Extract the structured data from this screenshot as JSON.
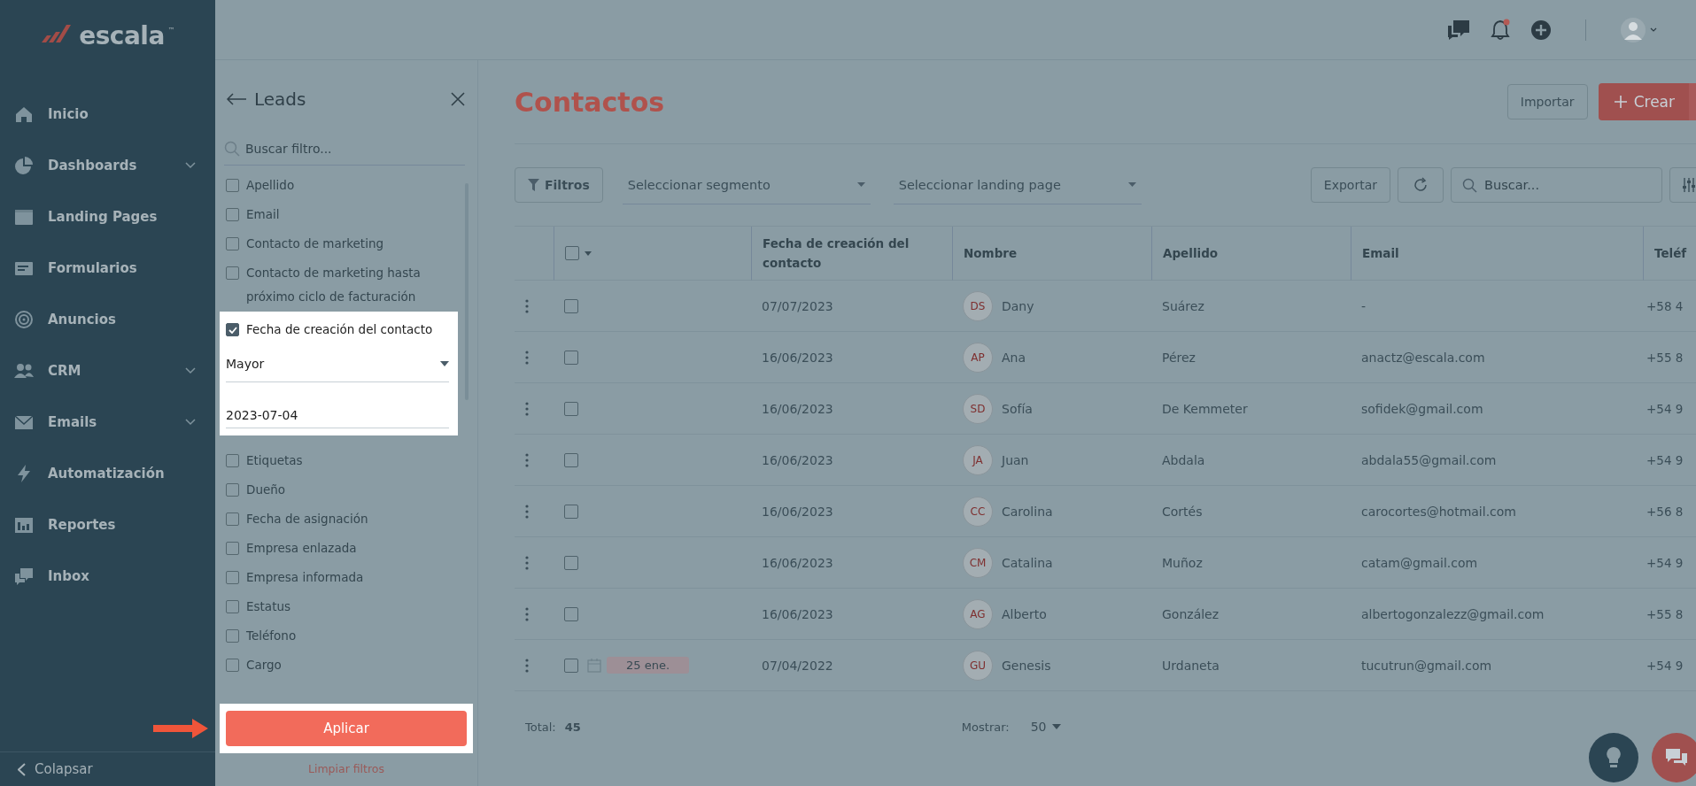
{
  "logo": {
    "text": "escala",
    "trademark": "™"
  },
  "nav": [
    {
      "label": "Inicio",
      "expandable": false
    },
    {
      "label": "Dashboards",
      "expandable": true
    },
    {
      "label": "Landing Pages",
      "expandable": false
    },
    {
      "label": "Formularios",
      "expandable": false
    },
    {
      "label": "Anuncios",
      "expandable": false
    },
    {
      "label": "CRM",
      "expandable": true
    },
    {
      "label": "Emails",
      "expandable": true
    },
    {
      "label": "Automatización",
      "expandable": false
    },
    {
      "label": "Reportes",
      "expandable": false
    },
    {
      "label": "Inbox",
      "expandable": false
    }
  ],
  "collapse": {
    "label": "Colapsar"
  },
  "header": {
    "has_notification": true
  },
  "filter_panel": {
    "title": "Leads",
    "search_placeholder": "Buscar filtro...",
    "filters": [
      {
        "label": "Apellido",
        "checked": false,
        "spotlight": false
      },
      {
        "label": "Email",
        "checked": false,
        "spotlight": false
      },
      {
        "label": "Contacto de marketing",
        "checked": false,
        "spotlight": false
      },
      {
        "label": "Contacto de marketing hasta próximo ciclo de facturación",
        "checked": false,
        "spotlight": false
      },
      {
        "label": "Fecha de creación del contacto",
        "checked": true,
        "spotlight": true,
        "condition": "Mayor",
        "value": "2023-07-04"
      },
      {
        "label": "Etiquetas",
        "checked": false,
        "spotlight": false
      },
      {
        "label": "Dueño",
        "checked": false,
        "spotlight": false
      },
      {
        "label": "Fecha de asignación",
        "checked": false,
        "spotlight": false
      },
      {
        "label": "Empresa enlazada",
        "checked": false,
        "spotlight": false
      },
      {
        "label": "Empresa informada",
        "checked": false,
        "spotlight": false
      },
      {
        "label": "Estatus",
        "checked": false,
        "spotlight": false
      },
      {
        "label": "Teléfono",
        "checked": false,
        "spotlight": false
      },
      {
        "label": "Cargo",
        "checked": false,
        "spotlight": false
      }
    ],
    "apply": {
      "label": "Aplicar",
      "spotlight": true
    },
    "clear": "Limpiar filtros"
  },
  "page": {
    "title": "Contactos",
    "import": "Importar",
    "create": "Crear"
  },
  "toolbar": {
    "filters": "Filtros",
    "segment_placeholder": "Seleccionar segmento",
    "landing_placeholder": "Seleccionar landing page",
    "export": "Exportar",
    "search_placeholder": "Buscar..."
  },
  "table": {
    "all_selected": false,
    "columns": [
      "Fecha de creación del contacto",
      "Nombre",
      "Apellido",
      "Email",
      "Teléf"
    ],
    "rows": [
      {
        "selected": false,
        "date": "07/07/2023",
        "initials": "DS",
        "name": "Dany",
        "surname": "Suárez",
        "email": "-",
        "phone": "+58 4"
      },
      {
        "selected": false,
        "date": "16/06/2023",
        "initials": "AP",
        "name": "Ana",
        "surname": "Pérez",
        "email": "anactz@escala.com",
        "phone": "+55 8"
      },
      {
        "selected": false,
        "date": "16/06/2023",
        "initials": "SD",
        "name": "Sofía",
        "surname": "De Kemmeter",
        "email": "sofidek@gmail.com",
        "phone": "+54 9"
      },
      {
        "selected": false,
        "date": "16/06/2023",
        "initials": "JA",
        "name": "Juan",
        "surname": "Abdala",
        "email": "abdala55@gmail.com",
        "phone": "+54 9"
      },
      {
        "selected": false,
        "date": "16/06/2023",
        "initials": "CC",
        "name": "Carolina",
        "surname": "Cortés",
        "email": "carocortes@hotmail.com",
        "phone": "+56 8"
      },
      {
        "selected": false,
        "date": "16/06/2023",
        "initials": "CM",
        "name": "Catalina",
        "surname": "Muñoz",
        "email": "catam@gmail.com",
        "phone": "+54 9"
      },
      {
        "selected": false,
        "date": "16/06/2023",
        "initials": "AG",
        "name": "Alberto",
        "surname": "González",
        "email": "albertogonzalezz@gmail.com",
        "phone": "+55 8"
      },
      {
        "selected": false,
        "date": "07/04/2022",
        "initials": "GU",
        "name": "Genesis",
        "surname": "Urdaneta",
        "email": "tucutrun@gmail.com",
        "phone": "+54 9",
        "task": "25 ene."
      }
    ]
  },
  "footer": {
    "total_label": "Total:",
    "total": "45",
    "show_label": "Mostrar:",
    "show": "50"
  }
}
